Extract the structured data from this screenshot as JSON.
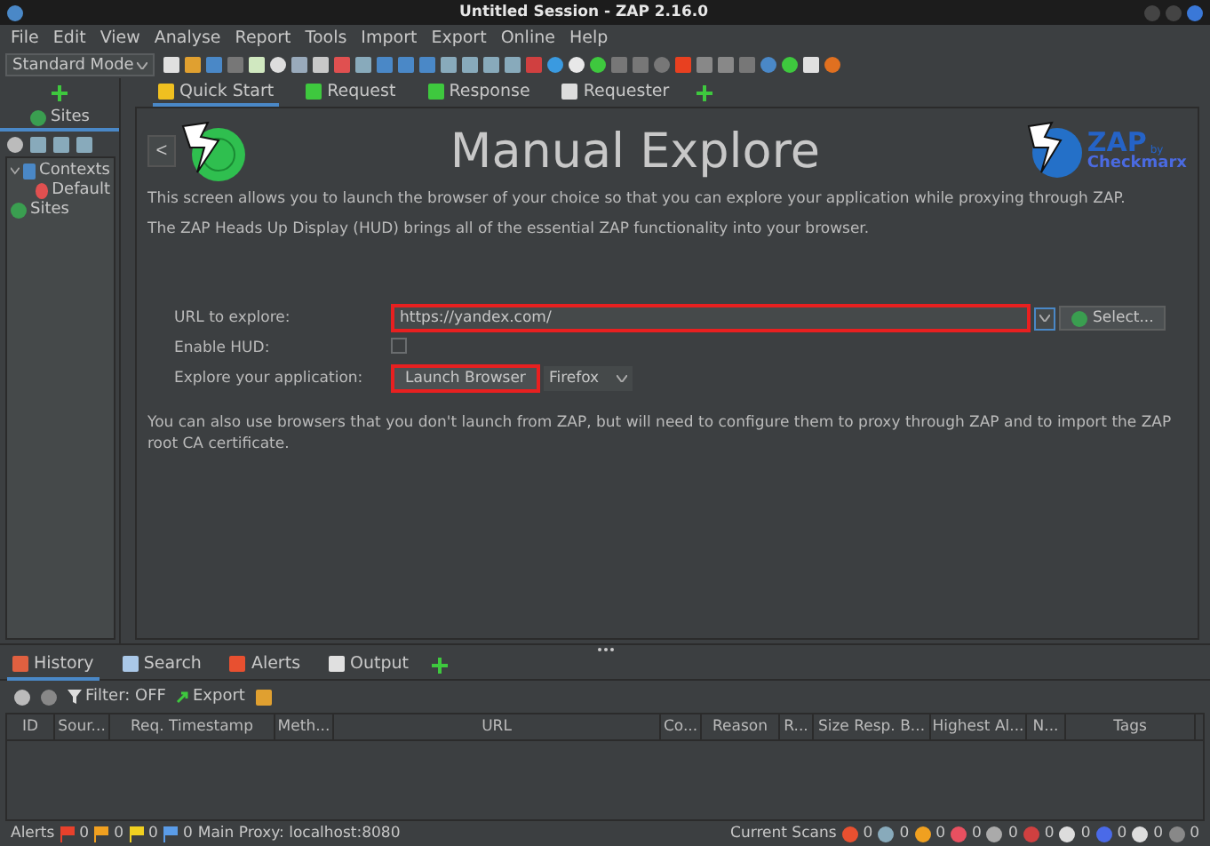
{
  "window": {
    "title": "Untitled Session - ZAP 2.16.0"
  },
  "menu": [
    "File",
    "Edit",
    "View",
    "Analyse",
    "Report",
    "Tools",
    "Import",
    "Export",
    "Online",
    "Help"
  ],
  "mode": "Standard Mode",
  "sites_panel": {
    "tab": "Sites",
    "tree": [
      {
        "label": "Contexts",
        "expanded": true,
        "children": [
          {
            "label": "Default"
          }
        ]
      },
      {
        "label": "Sites"
      }
    ]
  },
  "top_tabs": [
    {
      "label": "Quick Start",
      "selected": true,
      "kind": "start"
    },
    {
      "label": "Request",
      "selected": false,
      "kind": "request"
    },
    {
      "label": "Response",
      "selected": false,
      "kind": "response"
    },
    {
      "label": "Requester",
      "selected": false,
      "kind": "requester"
    }
  ],
  "quick_start": {
    "back": "<",
    "title": "Manual Explore",
    "logo_name": "ZAP",
    "logo_by": "by",
    "logo_brand": "Checkmarx",
    "intro": [
      "This screen allows you to launch the browser of your choice so that you can explore your application while proxying through ZAP.",
      "The ZAP Heads Up Display (HUD) brings all of the essential ZAP functionality into your browser."
    ],
    "url_label": "URL to explore:",
    "url_value": "https://yandex.com/",
    "url_highlighted": true,
    "select_button": "Select...",
    "hud_label": "Enable HUD:",
    "hud_checked": false,
    "explore_label": "Explore your application:",
    "launch_button": "Launch Browser",
    "launch_highlighted": true,
    "browser": "Firefox",
    "note": "You can also use browsers that you don't launch from ZAP, but will need to configure them to proxy through ZAP and to import the ZAP root CA certificate."
  },
  "bottom_tabs": [
    {
      "label": "History",
      "selected": true
    },
    {
      "label": "Search",
      "selected": false
    },
    {
      "label": "Alerts",
      "selected": false
    },
    {
      "label": "Output",
      "selected": false
    }
  ],
  "history_toolbar": {
    "filter": "Filter: OFF",
    "export": "Export"
  },
  "table": {
    "columns": [
      "ID",
      "Sour...",
      "Req. Timestamp",
      "Meth...",
      "URL",
      "Co...",
      "Reason",
      "R...",
      "Size Resp. B...",
      "Highest Al...",
      "N...",
      "Tags"
    ]
  },
  "status_bar": {
    "alerts_label": "Alerts",
    "alert_counts": [
      {
        "color": "#e8412c",
        "count": "0"
      },
      {
        "color": "#f0a020",
        "count": "0"
      },
      {
        "color": "#f0d020",
        "count": "0"
      },
      {
        "color": "#5a9ce8",
        "count": "0"
      }
    ],
    "proxy": "Main Proxy: localhost:8080",
    "scans_label": "Current Scans",
    "scan_counts": [
      "0",
      "0",
      "0",
      "0",
      "0",
      "0",
      "0",
      "0",
      "0",
      "0"
    ]
  }
}
